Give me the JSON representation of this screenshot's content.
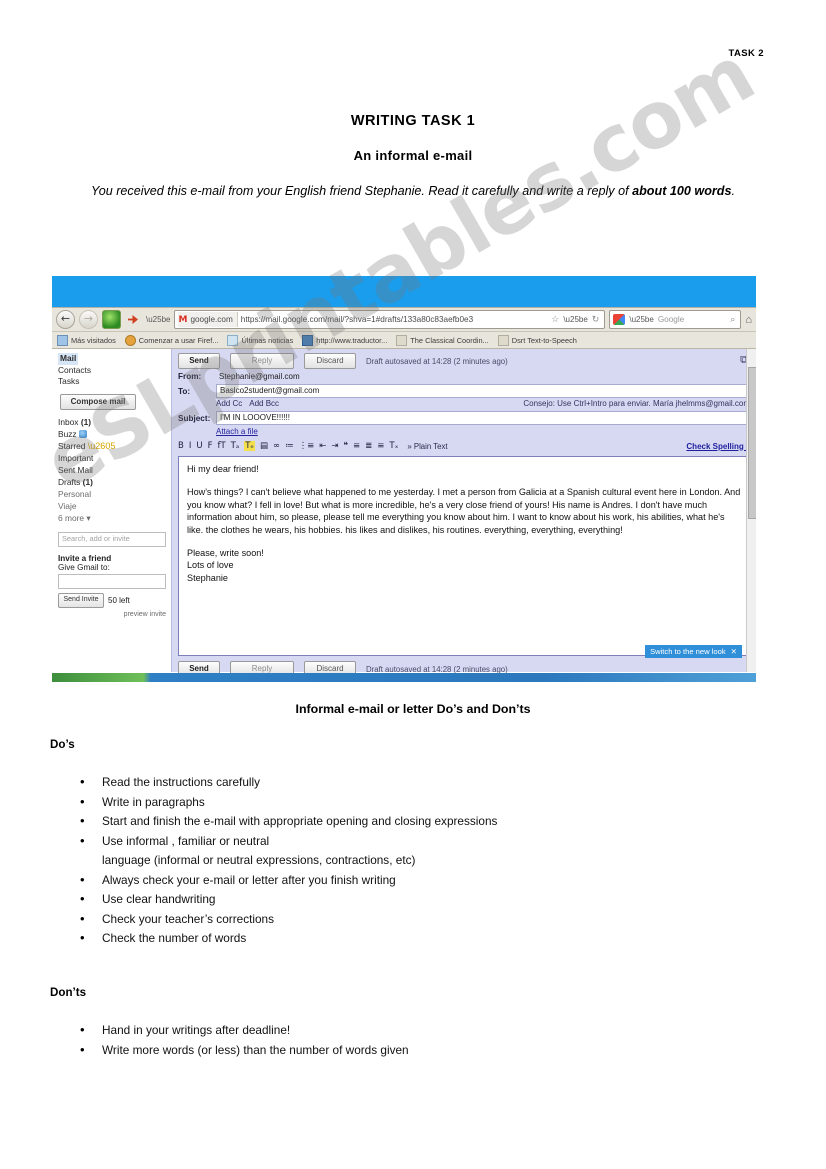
{
  "header": {
    "task_label": "TASK 2"
  },
  "titles": {
    "main": "WRITING TASK 1",
    "sub": "An informal e-mail",
    "intro_part1": "You received this e-mail from your English friend Stephanie. Read it carefully and write a reply of ",
    "intro_bold": "about 100 words",
    "intro_part2": "."
  },
  "browser": {
    "nav": {
      "back": "←",
      "forward": "→"
    },
    "url_chip": "google.com",
    "url_text": "https://mail.google.com/mail/?shva=1#drafts/133a80c83aefb0e3",
    "search_placeholder": "Google",
    "bookmarks": [
      "Más visitados",
      "Comenzar a usar Firef...",
      "Últimas noticias",
      "http://www.traductor...",
      "The Classical Coordin...",
      "Dsrt Text-to-Speech"
    ],
    "star_icon": "☆",
    "reload_icon": "↻",
    "home_icon": "⌂",
    "magnifier_icon": "⌕"
  },
  "gmail": {
    "nav_links": [
      "Mail",
      "Contacts",
      "Tasks"
    ],
    "compose_label": "Compose mail",
    "folders": [
      {
        "label": "Inbox",
        "count": "(1)"
      },
      {
        "label": "Buzz",
        "count": ""
      },
      {
        "label": "Starred",
        "count": ""
      },
      {
        "label": "Important",
        "count": ""
      },
      {
        "label": "Sent Mail",
        "count": ""
      },
      {
        "label": "Drafts",
        "count": "(1)"
      }
    ],
    "labels": [
      "Personal",
      "Viaje",
      "6 more ▾"
    ],
    "chat_search_placeholder": "Search, add or invite",
    "invite_title": "Invite a friend",
    "invite_sub": "Give Gmail to:",
    "invite_button": "Send Invite",
    "invite_left": "50 left",
    "preview_invite": "preview invite"
  },
  "compose": {
    "send_label": "Send",
    "reply_label": "Reply",
    "discard_label": "Discard",
    "autosave_top": "Draft autosaved at 14:28 (2 minutes ago)",
    "autosave_bottom": "Draft autosaved at 14:28 (2 minutes ago)",
    "popout_icon": "⧉",
    "from_label": "From:",
    "from_value": "Stephanie@gmail.com",
    "to_label": "To:",
    "to_value": "Baslco2student@gmail.com",
    "add_cc": "Add Cc",
    "add_bcc": "Add Bcc",
    "edit_contacts": "Consejo: Use Ctrl+Intro para enviar. María jhelmms@gmail.com",
    "subject_label": "Subject:",
    "subject_value": "I'M IN LOOOVE!!!!!!",
    "attach_label": "Attach a file",
    "plain_text_label": "» Plain Text",
    "check_spelling": "Check Spelling ▾",
    "format_icons": [
      "B",
      "I",
      "U",
      "F",
      "fT",
      "Tₐ",
      "Tₑ",
      "▤",
      "∞",
      "≔",
      "⋮≡",
      "⇤",
      "⇥",
      "❝",
      "≡",
      "≣",
      "≡",
      "Tₓ"
    ],
    "body": {
      "greeting": "Hi my dear friend!",
      "paragraph1": "How's things? I can't believe what happened to me yesterday. I met a person from Galicia at a Spanish cultural event here in London. And  you know what? I fell in love! But what is more incredible, he's a very close friend of yours! His name is Andres. I don't have much information about him, so please, please tell me everything you know about him. I want to know about his work, his abilities, what he's like. the clothes he wears, his hobbies. his likes and dislikes, his routines. everything, everything, everything!",
      "closing1": "Please, write soon!",
      "closing2": "Lots of love",
      "signature": "Stephanie"
    },
    "new_look_badge": "Switch to the new look",
    "new_look_close": "✕"
  },
  "dos_donts": {
    "title": "Informal e-mail or letter Do’s and Don’ts",
    "dos_heading": "Do’s",
    "dos": [
      "Read the instructions carefully",
      "Write in paragraphs",
      "Start and finish the e-mail with appropriate opening and closing expressions",
      "Use informal , familiar or neutral\nlanguage (informal or neutral expressions, contractions, etc)",
      "Always check your e-mail or letter after you finish writing",
      "Use clear handwriting",
      "Check your teacher’s corrections",
      "Check the number of words"
    ],
    "donts_heading": "Don’ts",
    "donts": [
      "Hand in your writings after deadline!",
      "Write more words (or less) than the number of words given"
    ]
  },
  "watermark": {
    "text": "eSLprintables.com"
  },
  "colors": {
    "title_bar_blue": "#1a9ded",
    "compose_lilac": "#d7d9f2",
    "badge_blue": "#2f8fd8",
    "selected_nav": "#d6e6f7"
  }
}
